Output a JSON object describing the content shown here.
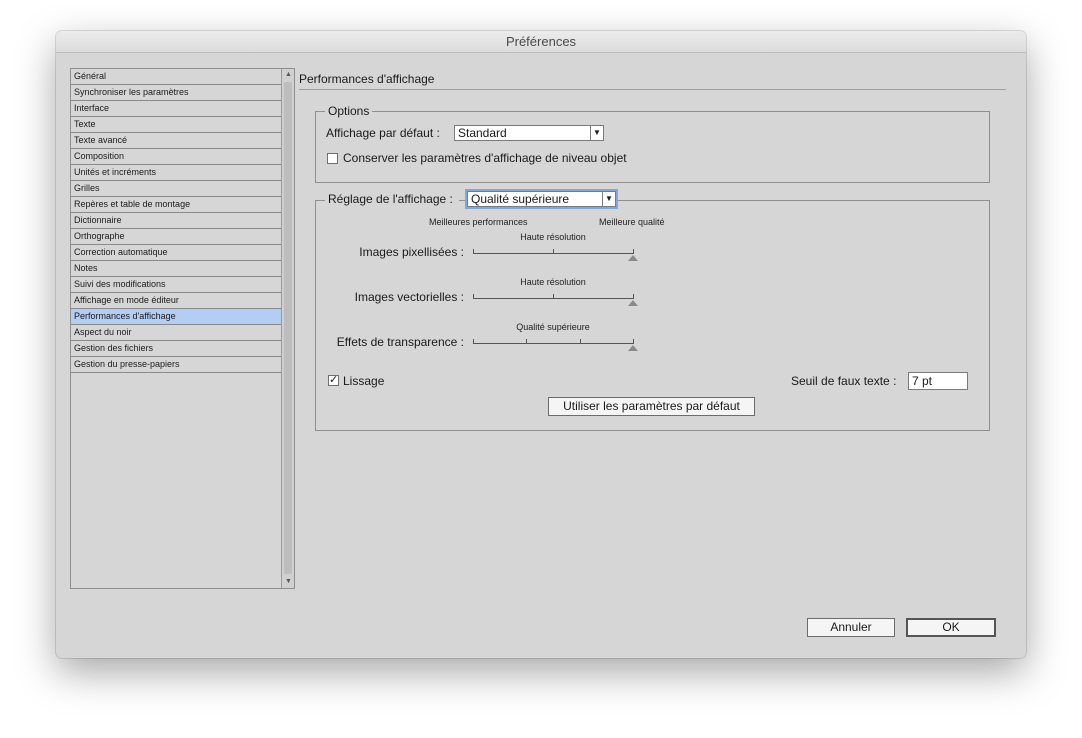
{
  "window": {
    "title": "Préférences"
  },
  "sidebar": {
    "items": [
      "Général",
      "Synchroniser les paramètres",
      "Interface",
      "Texte",
      "Texte avancé",
      "Composition",
      "Unités et incréments",
      "Grilles",
      "Repères et table de montage",
      "Dictionnaire",
      "Orthographe",
      "Correction automatique",
      "Notes",
      "Suivi des modifications",
      "Affichage en mode éditeur",
      "Performances d'affichage",
      "Aspect du noir",
      "Gestion des fichiers",
      "Gestion du presse-papiers"
    ],
    "selected_index": 15
  },
  "panel": {
    "title": "Performances d'affichage",
    "options": {
      "legend": "Options",
      "default_view_label": "Affichage par défaut :",
      "default_view_value": "Standard",
      "preserve_label": "Conserver les paramètres d'affichage de niveau objet",
      "preserve_checked": false
    },
    "adjust": {
      "legend_label": "Réglage de l'affichage :",
      "mode_value": "Qualité supérieure",
      "scale_left": "Meilleures performances",
      "scale_right": "Meilleure qualité",
      "sliders": [
        {
          "label": "Images pixellisées :",
          "value_label": "Haute résolution",
          "level": 1.0
        },
        {
          "label": "Images vectorielles :",
          "value_label": "Haute résolution",
          "level": 1.0
        },
        {
          "label": "Effets de transparence :",
          "value_label": "Qualité supérieure",
          "level": 1.0
        }
      ],
      "smoothing_label": "Lissage",
      "smoothing_checked": true,
      "greek_label": "Seuil de faux texte :",
      "greek_value": "7 pt",
      "defaults_button": "Utiliser les paramètres par défaut"
    }
  },
  "footer": {
    "cancel": "Annuler",
    "ok": "OK"
  }
}
